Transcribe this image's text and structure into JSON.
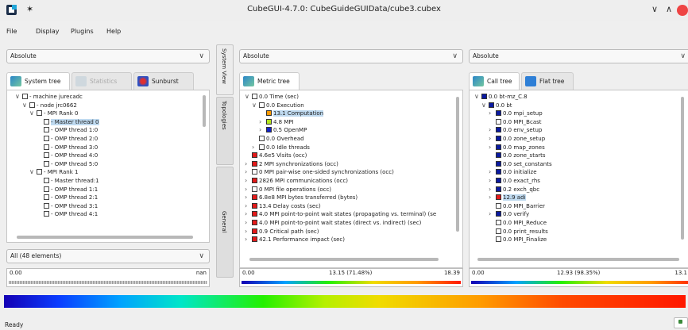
{
  "window": {
    "title": "CubeGUI-4.7.0: CubeGuideGUIData/cube3.cubex",
    "min": "∨",
    "max": "∧"
  },
  "menu": [
    "File",
    "Display",
    "Plugins",
    "Help"
  ],
  "left": {
    "combo": "Absolute",
    "tabs": [
      "System tree",
      "Statistics",
      "Sunburst"
    ],
    "rows": [
      {
        "indent": 0,
        "exp": "∨",
        "text": "- machine jurecadc"
      },
      {
        "indent": 1,
        "exp": "∨",
        "text": "- node jrc0662"
      },
      {
        "indent": 2,
        "exp": "∨",
        "text": "- MPI Rank 0"
      },
      {
        "indent": 3,
        "exp": "",
        "text": "- Master thread 0",
        "sel": true
      },
      {
        "indent": 3,
        "exp": "",
        "text": "- OMP thread 1:0"
      },
      {
        "indent": 3,
        "exp": "",
        "text": "- OMP thread 2:0"
      },
      {
        "indent": 3,
        "exp": "",
        "text": "- OMP thread 3:0"
      },
      {
        "indent": 3,
        "exp": "",
        "text": "- OMP thread 4:0"
      },
      {
        "indent": 3,
        "exp": "",
        "text": "- OMP thread 5:0"
      },
      {
        "indent": 2,
        "exp": "∨",
        "text": "- MPI Rank 1"
      },
      {
        "indent": 3,
        "exp": "",
        "text": "- Master thread:1"
      },
      {
        "indent": 3,
        "exp": "",
        "text": "- OMP thread 1:1"
      },
      {
        "indent": 3,
        "exp": "",
        "text": "- OMP thread 2:1"
      },
      {
        "indent": 3,
        "exp": "",
        "text": "- OMP thread 3:1"
      },
      {
        "indent": 3,
        "exp": "",
        "text": "- OMP thread 4:1"
      }
    ],
    "filter": "All (48 elements)",
    "scale_min": "0.00",
    "scale_max": "nan"
  },
  "vtabs": [
    "System View",
    "Topologies",
    "General"
  ],
  "middle": {
    "combo": "Absolute",
    "tab": "Metric tree",
    "rows": [
      {
        "indent": 0,
        "exp": "∨",
        "color": "",
        "text": "0.0 Time (sec)"
      },
      {
        "indent": 1,
        "exp": "∨",
        "color": "",
        "text": "0.0 Execution"
      },
      {
        "indent": 2,
        "exp": "",
        "color": "#ff9a00",
        "text": "13.1 Computation",
        "sel": true
      },
      {
        "indent": 2,
        "exp": "›",
        "color": "#b5e61d",
        "text": "4.8 MPI"
      },
      {
        "indent": 2,
        "exp": "›",
        "color": "#1020c8",
        "text": "0.5 OpenMP"
      },
      {
        "indent": 1,
        "exp": "",
        "color": "",
        "text": "0.0 Overhead"
      },
      {
        "indent": 1,
        "exp": "›",
        "color": "",
        "text": "0.0 Idle threads"
      },
      {
        "indent": 0,
        "exp": "",
        "color": "#e41a1a",
        "text": "4.6e5 Visits (occ)"
      },
      {
        "indent": 0,
        "exp": "›",
        "color": "#e41a1a",
        "text": "2 MPI synchronizations (occ)"
      },
      {
        "indent": 0,
        "exp": "›",
        "color": "",
        "text": "0 MPI pair-wise one-sided synchronizations (occ)"
      },
      {
        "indent": 0,
        "exp": "›",
        "color": "#e41a1a",
        "text": "2826 MPI communications (occ)"
      },
      {
        "indent": 0,
        "exp": "›",
        "color": "",
        "text": "0 MPI file operations (occ)"
      },
      {
        "indent": 0,
        "exp": "›",
        "color": "#e41a1a",
        "text": "6.8e8 MPI bytes transferred (bytes)"
      },
      {
        "indent": 0,
        "exp": "›",
        "color": "#e41a1a",
        "text": "13.4 Delay costs (sec)"
      },
      {
        "indent": 0,
        "exp": "›",
        "color": "#e41a1a",
        "text": "4.0 MPI point-to-point wait states (propagating vs. terminal) (se"
      },
      {
        "indent": 0,
        "exp": "›",
        "color": "#e41a1a",
        "text": "4.0 MPI point-to-point wait states (direct vs. indirect) (sec)"
      },
      {
        "indent": 0,
        "exp": "›",
        "color": "#e41a1a",
        "text": "0.9 Critical path (sec)"
      },
      {
        "indent": 0,
        "exp": "›",
        "color": "#e41a1a",
        "text": "42.1 Performance impact (sec)"
      }
    ],
    "scale_min": "0.00",
    "scale_mid": "13.15 (71.48%)",
    "scale_max": "18.39"
  },
  "right": {
    "combo": "Absolute",
    "tabs": [
      "Call tree",
      "Flat tree"
    ],
    "rows": [
      {
        "indent": 0,
        "exp": "∨",
        "color": "#0a1aa0",
        "text": "0.0 bt-mz_C.8"
      },
      {
        "indent": 1,
        "exp": "∨",
        "color": "#0a1aa0",
        "text": "0.0 bt"
      },
      {
        "indent": 2,
        "exp": "›",
        "color": "#0a1aa0",
        "text": "0.0 mpi_setup"
      },
      {
        "indent": 2,
        "exp": "",
        "color": "",
        "text": "0.0 MPI_Bcast"
      },
      {
        "indent": 2,
        "exp": "›",
        "color": "#0a1aa0",
        "text": "0.0 env_setup"
      },
      {
        "indent": 2,
        "exp": "›",
        "color": "#0a1aa0",
        "text": "0.0 zone_setup"
      },
      {
        "indent": 2,
        "exp": "›",
        "color": "#0a1aa0",
        "text": "0.0 map_zones"
      },
      {
        "indent": 2,
        "exp": "",
        "color": "#0a1aa0",
        "text": "0.0 zone_starts"
      },
      {
        "indent": 2,
        "exp": "",
        "color": "#0a1aa0",
        "text": "0.0 set_constants"
      },
      {
        "indent": 2,
        "exp": "›",
        "color": "#0a1aa0",
        "text": "0.0 initialize"
      },
      {
        "indent": 2,
        "exp": "›",
        "color": "#0a1aa0",
        "text": "0.0 exact_rhs"
      },
      {
        "indent": 2,
        "exp": "›",
        "color": "#0a1aa0",
        "text": "0.2 exch_qbc"
      },
      {
        "indent": 2,
        "exp": "›",
        "color": "#e41a1a",
        "text": "12.9 adi",
        "sel": true
      },
      {
        "indent": 2,
        "exp": "",
        "color": "",
        "text": "0.0 MPI_Barrier"
      },
      {
        "indent": 2,
        "exp": "›",
        "color": "#0a1aa0",
        "text": "0.0 verify"
      },
      {
        "indent": 2,
        "exp": "",
        "color": "",
        "text": "0.0 MPI_Reduce"
      },
      {
        "indent": 2,
        "exp": "",
        "color": "",
        "text": "0.0 print_results"
      },
      {
        "indent": 2,
        "exp": "",
        "color": "",
        "text": "0.0 MPI_Finalize"
      }
    ],
    "scale_min": "0.00",
    "scale_mid": "12.93 (98.35%)",
    "scale_max": "13.1"
  },
  "status": "Ready"
}
